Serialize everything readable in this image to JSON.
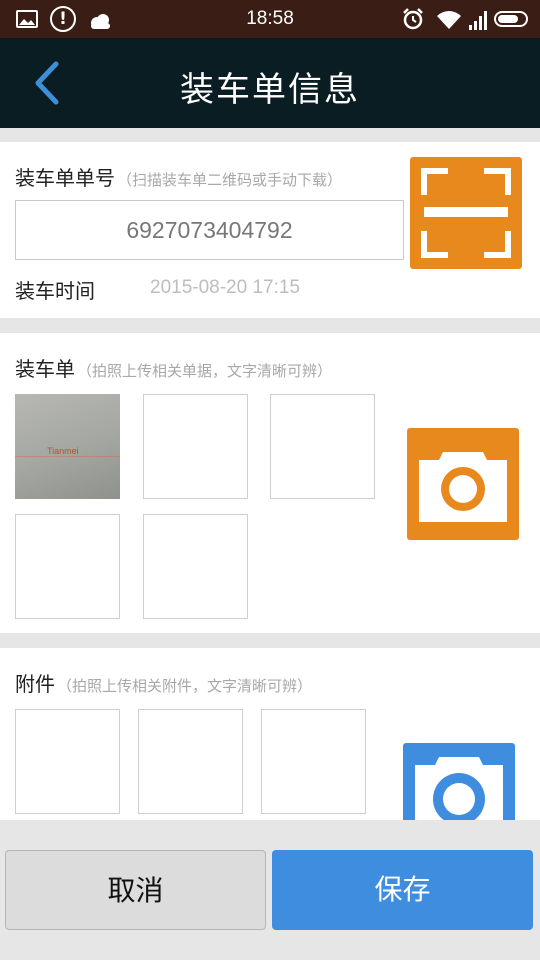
{
  "status_bar": {
    "time": "18:58",
    "icons": [
      "gallery-icon",
      "alert-icon",
      "cloud-icon",
      "alarm-icon",
      "wifi-icon",
      "signal-icon",
      "battery-icon"
    ]
  },
  "nav": {
    "title": "装车单信息",
    "back_icon": "chevron-left-icon"
  },
  "order": {
    "label": "装车单单号",
    "hint": "（扫描装车单二维码或手动下载）",
    "value": "6927073404792",
    "time_label": "装车时间",
    "time_value": "2015-08-20 17:15",
    "scan_icon": "scan-icon"
  },
  "loading_sheet": {
    "label": "装车单",
    "hint": "（拍照上传相关单据，文字清晰可辨）",
    "thumbnail_text": "Tianmei",
    "camera_icon": "camera-icon"
  },
  "attachments": {
    "label": "附件",
    "hint": "（拍照上传相关附件，文字清晰可辨）",
    "camera_icon": "camera-icon"
  },
  "footer": {
    "cancel_label": "取消",
    "save_label": "保存"
  },
  "colors": {
    "status_bar": "#3a1e16",
    "nav_bar": "#0a1d22",
    "accent_orange": "#e8891d",
    "accent_blue": "#3e8ddf",
    "back_arrow": "#3d8fd8"
  }
}
